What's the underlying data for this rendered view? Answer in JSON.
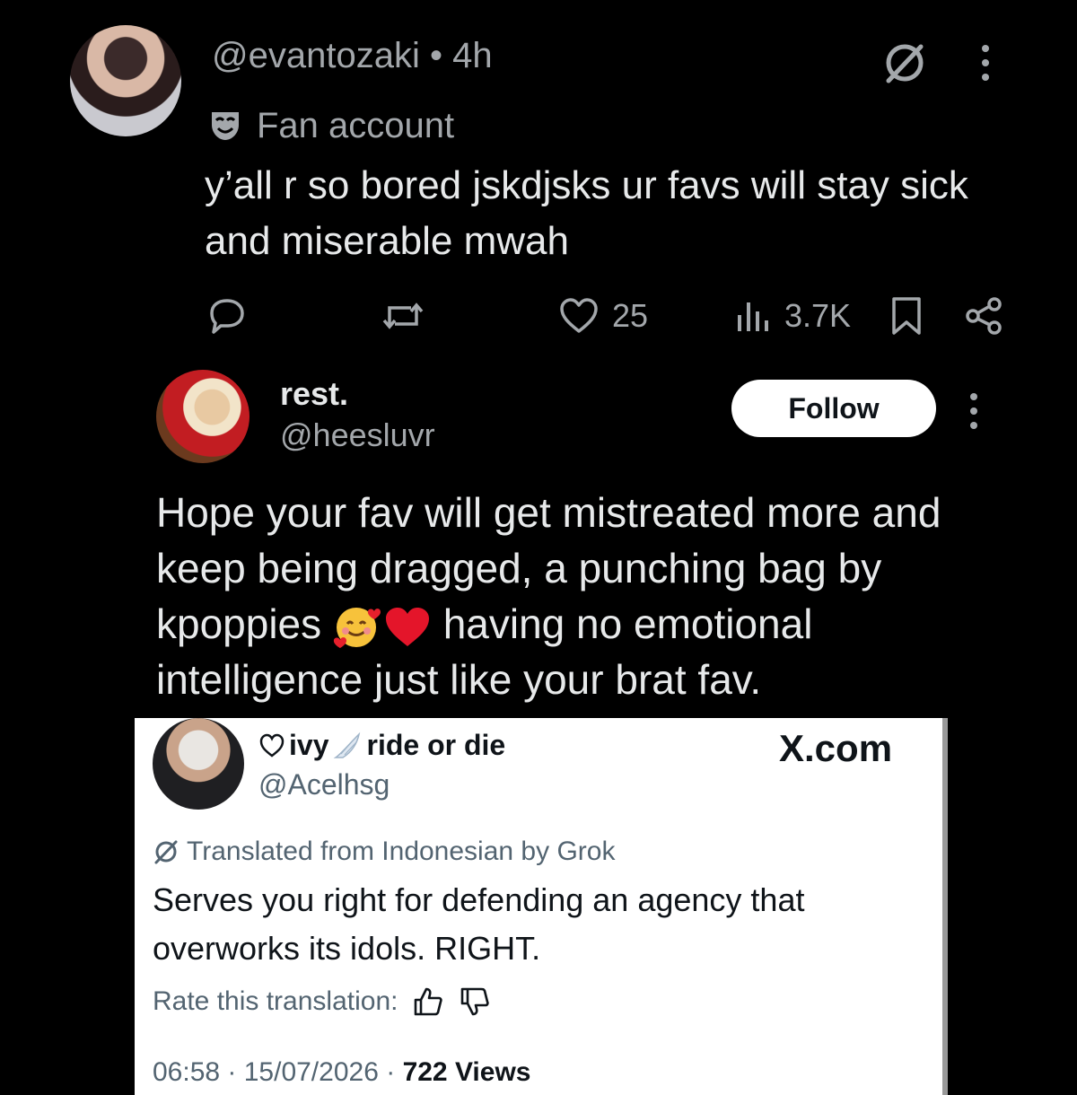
{
  "tweet1": {
    "handle": "@evantozaki",
    "separator": "•",
    "time": "4h",
    "label": "Fan account",
    "text": "y’all r so bored jskdjsks ur favs will stay sick and miserable mwah",
    "likes": "25",
    "views": "3.7K"
  },
  "tweet2": {
    "name": "rest.",
    "handle": "@heesluvr",
    "follow_label": "Follow",
    "text_before_emoji": "Hope your fav will get mistreated more and keep being dragged, a punching bag by kpoppies",
    "text_after_emoji": "having no emotional intelligence just like your brat fav."
  },
  "card": {
    "name_prefix": "ivy",
    "name_suffix": "ride or die",
    "handle": "@Acelhsg",
    "site": "X.com",
    "translated_label": "Translated from Indonesian by Grok",
    "text": "Serves you right for defending an agency that overworks its idols. RIGHT.",
    "rate_label": "Rate this translation:",
    "meta": "06:58 · 15/07/2026 ·",
    "views": "722 Views"
  },
  "icons": {
    "grok": "grok-icon",
    "more": "more-dots-icon",
    "mask": "mask-icon",
    "reply": "reply-icon",
    "retweet": "retweet-icon",
    "like": "heart-icon",
    "views": "views-icon",
    "bookmark": "bookmark-icon",
    "share": "share-icon",
    "thumbs_up": "thumbs-up-icon",
    "thumbs_down": "thumbs-down-icon"
  },
  "colors": {
    "background": "#000000",
    "text": "#e7e9ea",
    "muted": "#a3a7ab",
    "card_bg": "#ffffff",
    "card_muted": "#536471"
  }
}
